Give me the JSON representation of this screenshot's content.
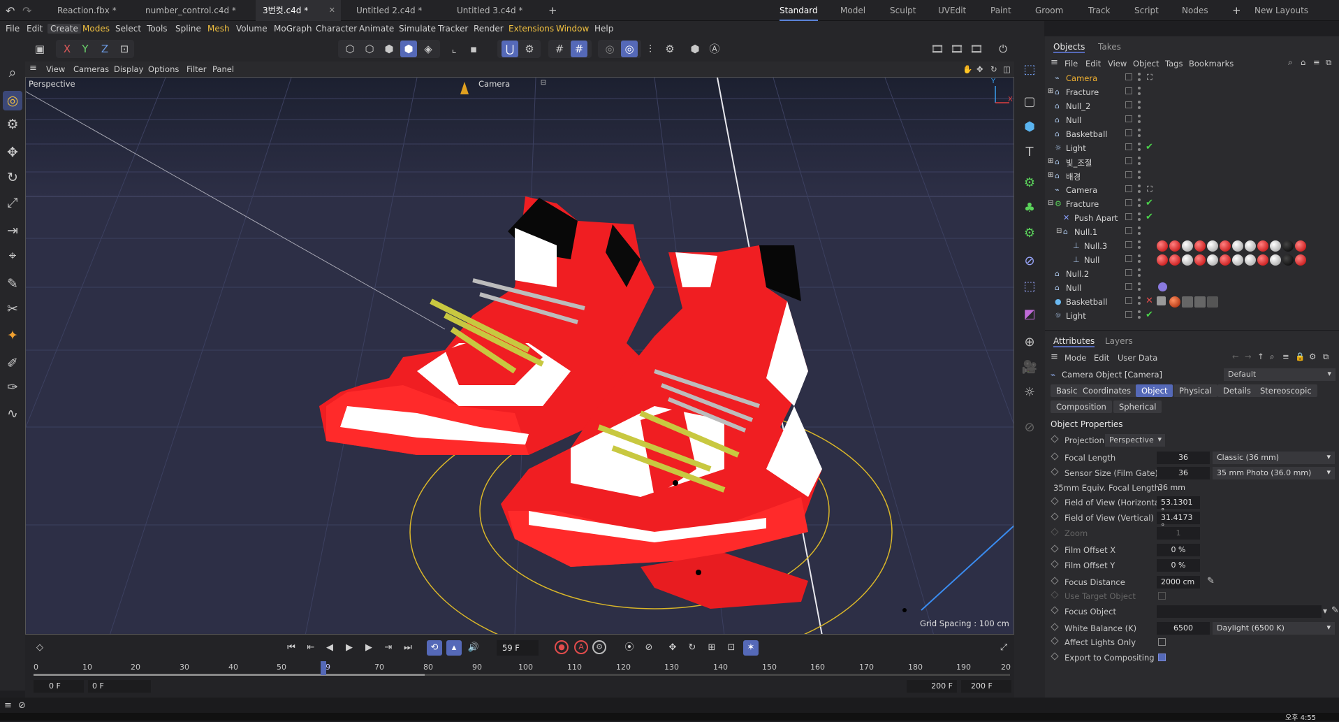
{
  "tabs": [
    {
      "label": "Reaction.fbx *",
      "active": false
    },
    {
      "label": "number_control.c4d *",
      "active": false
    },
    {
      "label": "3번컷.c4d *",
      "active": true
    },
    {
      "label": "Untitled 2.c4d *",
      "active": false
    },
    {
      "label": "Untitled 3.c4d *",
      "active": false
    }
  ],
  "layouts": [
    "Standard",
    "Model",
    "Sculpt",
    "UVEdit",
    "Paint",
    "Groom",
    "Track",
    "Script",
    "Nodes"
  ],
  "new_layouts": "New Layouts",
  "menus": [
    "File",
    "Edit",
    "Create",
    "Modes",
    "Select",
    "Tools",
    "Spline",
    "Mesh",
    "Volume",
    "MoGraph",
    "Character",
    "Animate",
    "Simulate",
    "Tracker",
    "Render",
    "Extensions",
    "Window",
    "Help"
  ],
  "axis_buttons": [
    "X",
    "Y",
    "Z"
  ],
  "viewport": {
    "menu": [
      "View",
      "Cameras",
      "Display",
      "Options",
      "Filter",
      "Panel"
    ],
    "view_name": "Perspective",
    "camera_label": "Camera",
    "grid_spacing": "Grid Spacing : 100 cm",
    "axis_y": "Y",
    "axis_x": "X",
    "bg_color": "#2d2f46"
  },
  "timeline": {
    "current_frame": "59 F",
    "ruler": [
      "0",
      "10",
      "20",
      "30",
      "40",
      "50",
      "59",
      "70",
      "80",
      "90",
      "100",
      "110",
      "120",
      "130",
      "140",
      "150",
      "160",
      "170",
      "180",
      "190",
      "20"
    ],
    "start_a": "0 F",
    "start_b": "0 F",
    "end_a": "200 F",
    "end_b": "200 F"
  },
  "objects": {
    "tabs": [
      "Objects",
      "Takes"
    ],
    "menu": [
      "File",
      "Edit",
      "View",
      "Object",
      "Tags",
      "Bookmarks"
    ],
    "rows": [
      {
        "name": "Camera",
        "icon": "camera-icon",
        "active": true
      },
      {
        "name": "Fracture",
        "icon": "fracture-icon"
      },
      {
        "name": "Null_2",
        "icon": "null-icon"
      },
      {
        "name": "Null",
        "icon": "null-icon"
      },
      {
        "name": "Basketball",
        "icon": "null-icon"
      },
      {
        "name": "Light",
        "icon": "light-icon",
        "check": true
      },
      {
        "name": "빛_조절",
        "icon": "null-icon"
      },
      {
        "name": "배경",
        "icon": "null-icon"
      },
      {
        "name": "Camera",
        "icon": "camera-icon"
      },
      {
        "name": "Fracture",
        "icon": "fracture-icon",
        "check": true
      },
      {
        "name": "Push Apart",
        "icon": "effector-icon",
        "check": true
      },
      {
        "name": "Null.1",
        "icon": "null-icon"
      },
      {
        "name": "Null.3",
        "icon": "null-icon",
        "materials": true
      },
      {
        "name": "Null",
        "icon": "null-icon",
        "materials": true
      },
      {
        "name": "Null.2",
        "icon": "null-icon"
      },
      {
        "name": "Null",
        "icon": "null-icon"
      },
      {
        "name": "Basketball",
        "icon": "sphere-icon",
        "cross": true
      },
      {
        "name": "Light",
        "icon": "light-icon",
        "check": true
      }
    ]
  },
  "attributes": {
    "tabs": [
      "Attributes",
      "Layers"
    ],
    "menu": [
      "Mode",
      "Edit",
      "User Data"
    ],
    "object_title": "Camera Object [Camera]",
    "preset": "Default",
    "subtabs": [
      "Basic",
      "Coordinates",
      "Object",
      "Physical",
      "Details",
      "Stereoscopic",
      "Composition",
      "Spherical"
    ],
    "section": "Object Properties",
    "projection_label": "Projection",
    "projection_value": "Perspective",
    "props": [
      {
        "label": "Focal Length",
        "value": "36",
        "dropdown": "Classic (36 mm)"
      },
      {
        "label": "Sensor Size (Film Gate)",
        "value": "36",
        "dropdown": "35 mm Photo (36.0 mm)"
      },
      {
        "label": "35mm Equiv. Focal Length:",
        "value": "36 mm",
        "static": true
      },
      {
        "label": "Field of View (Horizontal)",
        "value": "53.1301 °"
      },
      {
        "label": "Field of View (Vertical)",
        "value": "31.4173 °"
      },
      {
        "label": "Zoom",
        "value": "1",
        "dim": true
      },
      {
        "label": "Film Offset X",
        "value": "0 %"
      },
      {
        "label": "Film Offset Y",
        "value": "0 %"
      },
      {
        "label": "Focus Distance",
        "value": "2000 cm"
      },
      {
        "label": "Use Target Object",
        "checkbox": false,
        "dim": true
      },
      {
        "label": "Focus Object",
        "value": ""
      },
      {
        "label": "White Balance (K)",
        "value": "6500",
        "dropdown": "Daylight (6500 K)"
      },
      {
        "label": "Affect Lights Only",
        "checkbox": false
      },
      {
        "label": "Export to Compositing",
        "checkbox": true
      }
    ]
  },
  "status": {
    "time": "오후 4:55"
  }
}
